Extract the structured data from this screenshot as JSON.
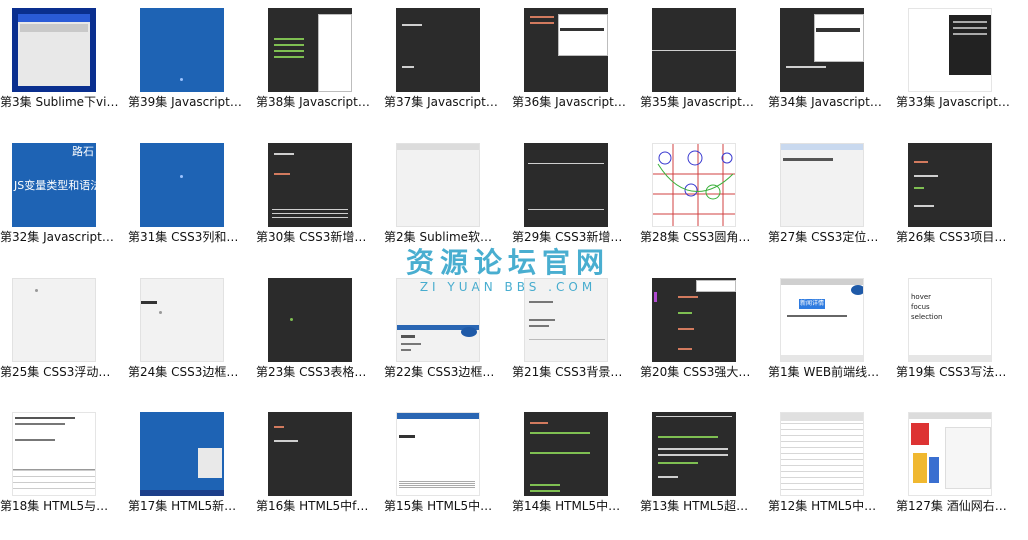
{
  "items": [
    {
      "label": "第3集 Sublime下vi…"
    },
    {
      "label": "第39集 Javascript…"
    },
    {
      "label": "第38集 Javascript…"
    },
    {
      "label": "第37集 Javascript…"
    },
    {
      "label": "第36集 Javascript…"
    },
    {
      "label": "第35集 Javascript…"
    },
    {
      "label": "第34集 Javascript…"
    },
    {
      "label": "第33集 Javascript…"
    },
    {
      "label": "第32集 Javascript…",
      "thumb_text": "JS变量类型和语法",
      "thumb_corner": "路石"
    },
    {
      "label": "第31集 CSS3列和…"
    },
    {
      "label": "第30集 CSS3新增…"
    },
    {
      "label": "第2集 Sublime软…"
    },
    {
      "label": "第29集 CSS3新增…"
    },
    {
      "label": "第28集 CSS3圆角…"
    },
    {
      "label": "第27集 CSS3定位…"
    },
    {
      "label": "第26集 CSS3项目…"
    },
    {
      "label": "第25集 CSS3浮动…"
    },
    {
      "label": "第24集 CSS3边框…"
    },
    {
      "label": "第23集 CSS3表格…"
    },
    {
      "label": "第22集 CSS3边框…"
    },
    {
      "label": "第21集 CSS3背景…"
    },
    {
      "label": "第20集 CSS3强大…"
    },
    {
      "label": "第1集 WEB前端线…",
      "thumb_button": "新闻详情"
    },
    {
      "label": "第19集 CSS3写法…",
      "thumb_lines": [
        "hover",
        "focus",
        "selection"
      ]
    },
    {
      "label": "第18集 HTML5与…"
    },
    {
      "label": "第17集 HTML5新…"
    },
    {
      "label": "第16集 HTML5中f…"
    },
    {
      "label": "第15集 HTML5中…"
    },
    {
      "label": "第14集 HTML5中…"
    },
    {
      "label": "第13集 HTML5超…"
    },
    {
      "label": "第12集 HTML5中…"
    },
    {
      "label": "第127集 酒仙网右…"
    }
  ],
  "watermark": {
    "title": "资源论坛官网",
    "subtitle": "ZI YUAN BBS .COM"
  }
}
